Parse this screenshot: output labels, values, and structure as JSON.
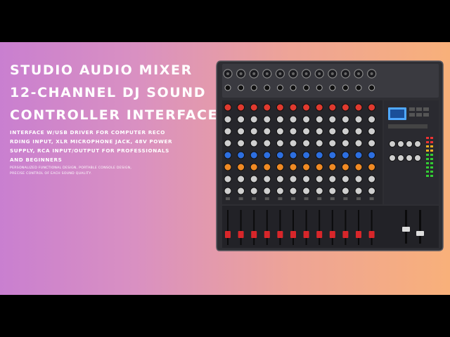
{
  "title_lines": [
    "STUDIO AUDIO MIXER",
    "12-CHANNEL DJ SOUND",
    "CONTROLLER INTERFACE"
  ],
  "description_lines": [
    "INTERFACE W/USB DRIVER FOR COMPUTER RECO",
    "RDING INPUT, XLR MICROPHONE JACK, 48V POWER",
    "SUPPLY, RCA INPUT/OUTPUT FOR PROFESSIONALS",
    "AND BEGINNERS"
  ],
  "small_lines": [
    "PERSONALIZED FUNCTIONAL DESIGN, PORTABLE CONSOLE DESIGN,",
    "PRECISE CONTROL OF EACH SOUND QUALITY."
  ],
  "colors": {
    "gradient_left": "#c97fd0",
    "gradient_right": "#f8b07a",
    "text": "#ffffff",
    "mixer_body": "#2e2e33",
    "knob_red": "#e03a2f",
    "knob_blue": "#2d6fe0",
    "knob_orange": "#f08a24",
    "fader_cap_red": "#d8262a"
  },
  "product_image": {
    "name": "12-channel audio mixer console",
    "channel_count": 12
  }
}
